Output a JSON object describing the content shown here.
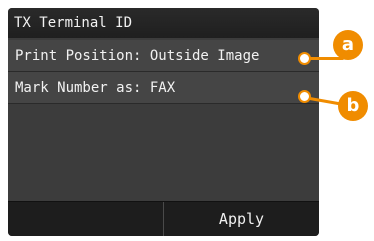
{
  "screen": {
    "title": "TX Terminal ID",
    "items": [
      {
        "label": "Print Position: Outside Image"
      },
      {
        "label": "Mark Number as: FAX"
      }
    ],
    "footer": {
      "left_label": "",
      "right_label": "Apply"
    }
  },
  "callouts": [
    {
      "label": "a"
    },
    {
      "label": "b"
    }
  ],
  "colors": {
    "accent": "#f08c00",
    "screen_bg": "#3c3c3c"
  }
}
